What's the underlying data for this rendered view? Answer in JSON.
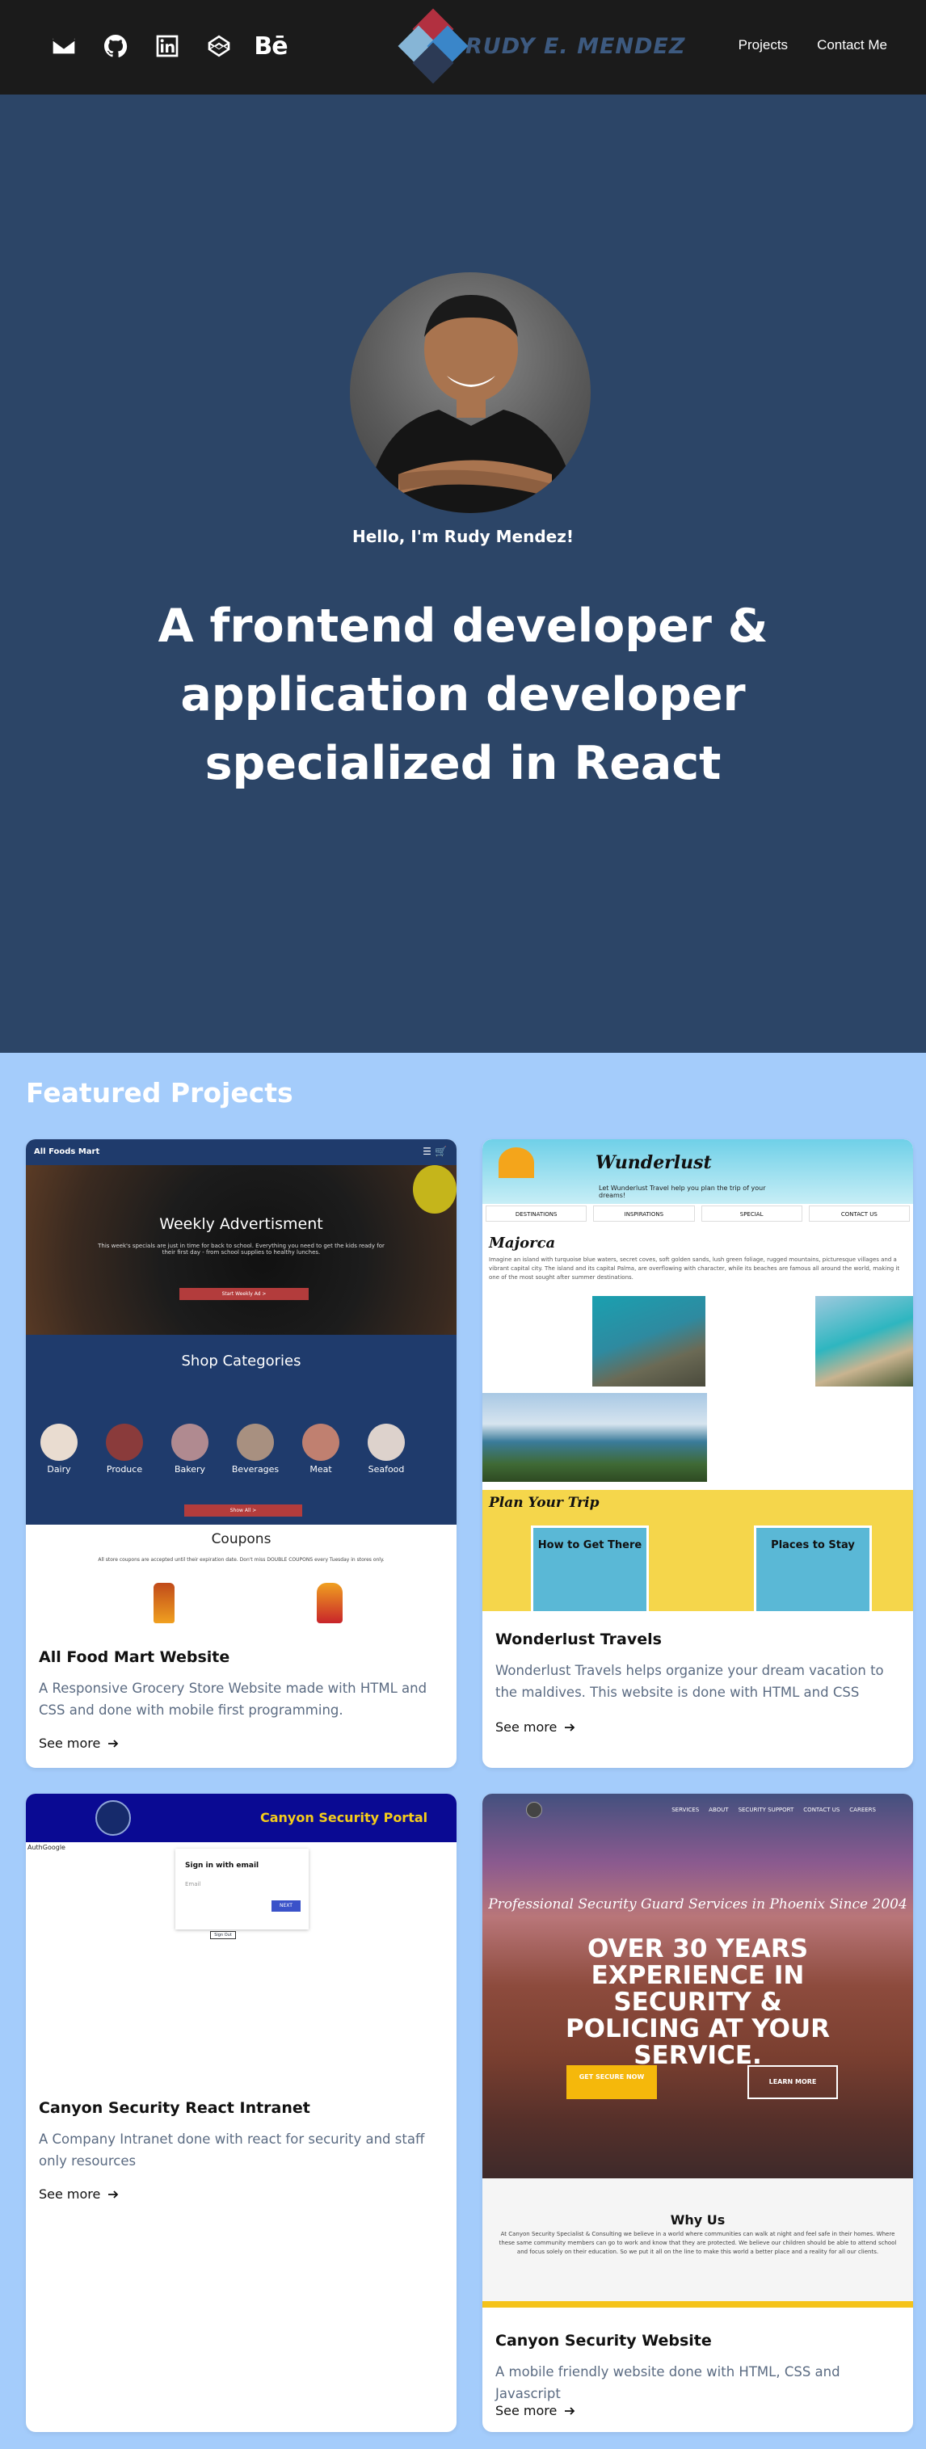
{
  "nav": {
    "icons": [
      "mail-icon",
      "github-icon",
      "linkedin-icon",
      "codepen-icon",
      "behance-icon"
    ],
    "behance_label": "Bē",
    "logo_text": "RUDY E. MENDEZ",
    "links": [
      "Projects",
      "Contact Me"
    ]
  },
  "hero": {
    "greeting": "Hello, I'm Rudy Mendez!",
    "title": "A frontend developer & application developer specialized in React"
  },
  "featured": {
    "title": "Featured Projects",
    "see_more": "See more",
    "projects": [
      {
        "title": "All Food Mart Website",
        "description": "A Responsive Grocery Store Website made with HTML and CSS and done with mobile first programming.",
        "shot": {
          "brand": "All Foods Mart",
          "hero_title": "Weekly Advertisment",
          "hero_text": "This week's specials are just in time for back to school. Everything you need to get the kids ready for their first day - from school supplies to healthy lunches.",
          "hero_button": "Start Weekly Ad >",
          "categories_title": "Shop Categories",
          "categories": [
            "Dairy",
            "Produce",
            "Bakery",
            "Beverages",
            "Meat",
            "Seafood"
          ],
          "categories_button": "Show All >",
          "coupons_title": "Coupons",
          "coupons_text": "All store coupons are accepted until their expiration date. Don't miss DOUBLE COUPONS every Tuesday in stores only."
        }
      },
      {
        "title": "Wonderlust Travels",
        "description": "Wonderlust Travels helps organize your dream vacation to the maldives. This website is done with HTML and CSS",
        "shot": {
          "logo": "Wunderlust",
          "tagline": "Let Wunderlust Travel help you plan the trip of your dreams!",
          "nav": [
            "DESTINATIONS",
            "INSPIRATIONS",
            "SPECIAL",
            "CONTACT US"
          ],
          "heading": "Majorca",
          "text": "Imagine an island with turquoise blue waters, secret coves, soft golden sands, lush green foliage, rugged mountains, picturesque villages and a vibrant capital city. The island and its capital Palma, are overflowing with character, while its beaches are famous all around the world, making it one of the most sought after summer destinations.",
          "plan_title": "Plan Your Trip",
          "tiles": [
            "How to Get There",
            "Places to Stay"
          ]
        }
      },
      {
        "title": "Canyon Security React Intranet",
        "description": "A Company Intranet done with react for security and staff only resources",
        "shot": {
          "portal_title": "Canyon Security Portal",
          "auth_label": "AuthGoogle",
          "signin_title": "Sign in with email",
          "email_placeholder": "Email",
          "next_label": "NEXT",
          "signout_label": "Sign Out"
        }
      },
      {
        "title": "Canyon Security Website",
        "description": "A mobile friendly website done with HTML, CSS and Javascript",
        "shot": {
          "nav": [
            "SERVICES",
            "ABOUT",
            "SECURITY SUPPORT",
            "CONTACT US",
            "CAREERS"
          ],
          "subtitle": "Professional Security Guard Services in Phoenix Since 2004",
          "headline": "OVER 30 YEARS EXPERIENCE IN SECURITY & POLICING AT YOUR SERVICE.",
          "cta_primary": "GET SECURE NOW",
          "cta_secondary": "LEARN MORE",
          "why_title": "Why Us",
          "why_text": "At Canyon Security Specialist & Consulting we believe in a world where communities can walk at night and feel safe in their homes. Where these same community members can go to work and know that they are protected. We believe our children should be able to attend school and focus solely on their education. So we put it all on the line to make this world a better place and a reality for all our clients."
        }
      }
    ]
  }
}
